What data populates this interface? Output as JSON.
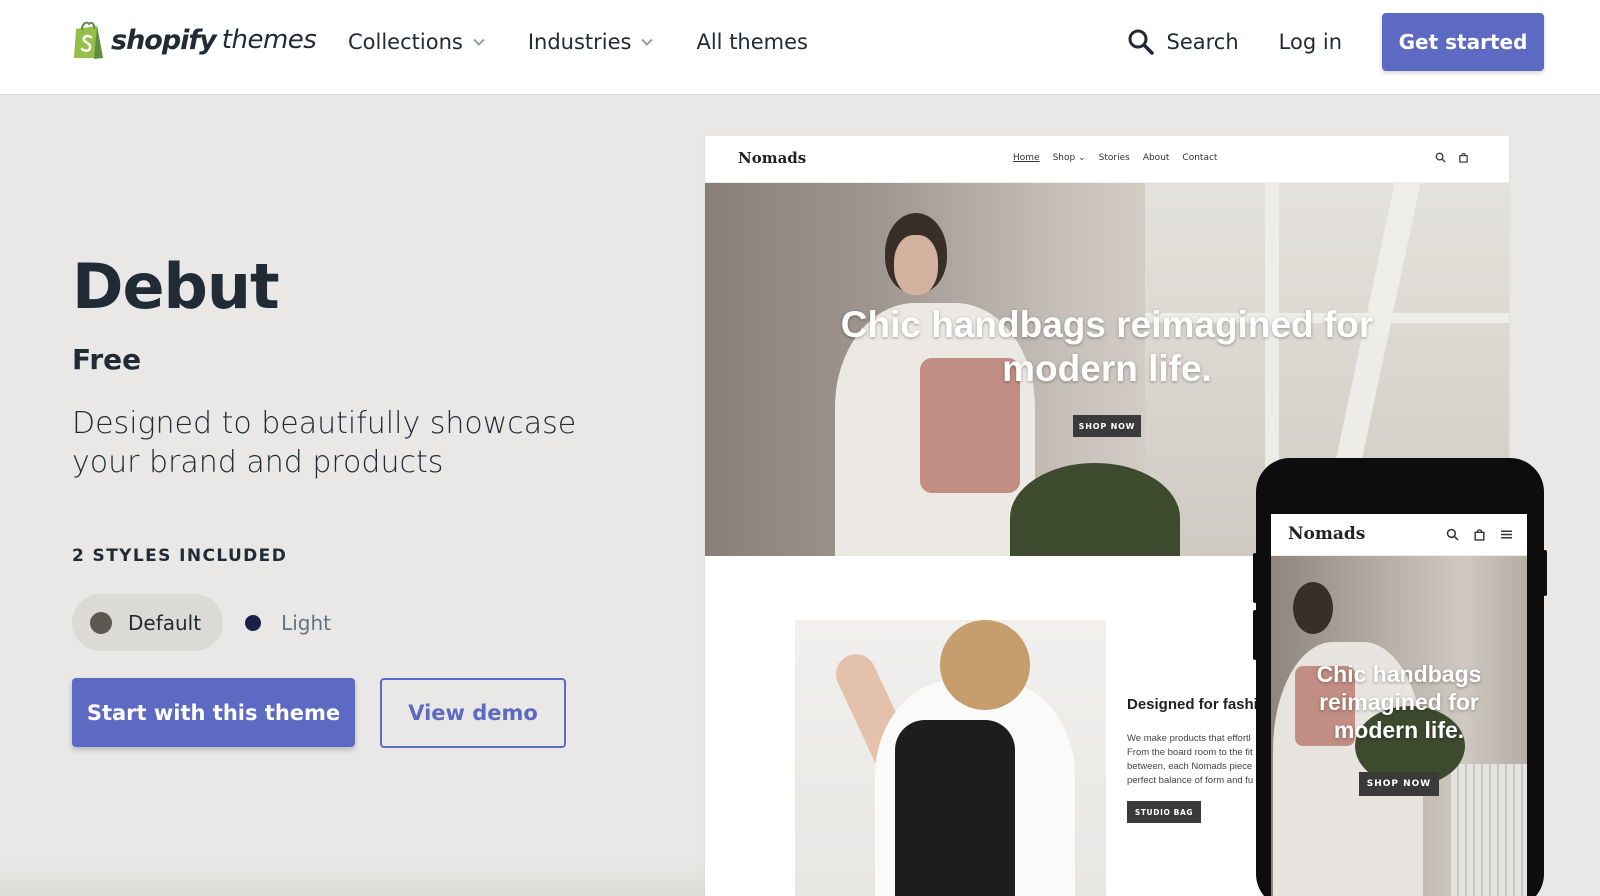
{
  "header": {
    "logo_brand": "shopify",
    "logo_suffix": "themes",
    "nav": [
      {
        "label": "Collections",
        "has_dropdown": true
      },
      {
        "label": "Industries",
        "has_dropdown": true
      },
      {
        "label": "All themes",
        "has_dropdown": false
      }
    ],
    "search_label": "Search",
    "login_label": "Log in",
    "cta_label": "Get started"
  },
  "theme": {
    "name": "Debut",
    "price": "Free",
    "description": "Designed to beautifully showcase your brand and products",
    "styles_heading": "2 STYLES INCLUDED",
    "styles": [
      {
        "label": "Default",
        "color": "#5e5651",
        "selected": true
      },
      {
        "label": "Light",
        "color": "#1b2047",
        "selected": false
      }
    ],
    "primary_button": "Start with this theme",
    "secondary_button": "View demo"
  },
  "preview": {
    "desktop": {
      "brand": "Nomads",
      "nav_links": [
        "Home",
        "Shop ⌄",
        "Stories",
        "About",
        "Contact"
      ],
      "hero_title": "Chic handbags reimagined for modern life.",
      "hero_button": "SHOP NOW",
      "feature_title": "Designed for fashi",
      "feature_text": "We make products that effortl From the board room to the fit between, each Nomads piece perfect balance of form and fu",
      "feature_button": "STUDIO BAG"
    },
    "mobile": {
      "brand": "Nomads",
      "hero_title": "Chic handbags reimagined for modern life.",
      "hero_button": "SHOP NOW"
    }
  },
  "colors": {
    "accent": "#5c6ac4",
    "page_background": "#e9e8e6",
    "text": "#212b36"
  },
  "icons": [
    "shopify-bag-icon",
    "chevron-down-icon",
    "search-icon",
    "cart-icon",
    "menu-icon"
  ]
}
